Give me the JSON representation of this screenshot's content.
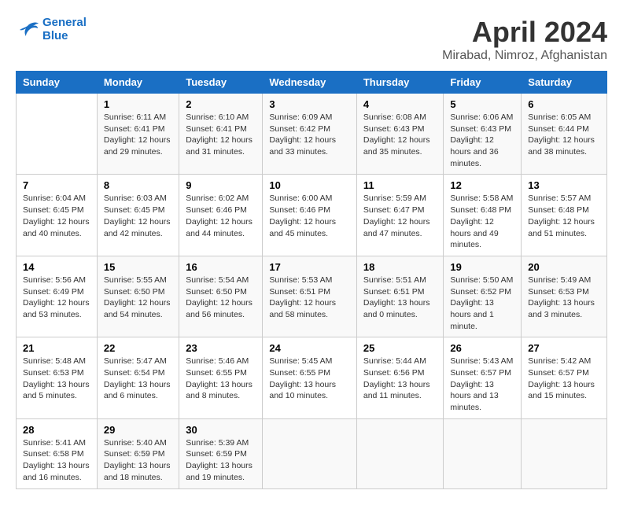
{
  "header": {
    "logo_line1": "General",
    "logo_line2": "Blue",
    "title": "April 2024",
    "subtitle": "Mirabad, Nimroz, Afghanistan"
  },
  "days_of_week": [
    "Sunday",
    "Monday",
    "Tuesday",
    "Wednesday",
    "Thursday",
    "Friday",
    "Saturday"
  ],
  "weeks": [
    [
      {
        "day": "",
        "sunrise": "",
        "sunset": "",
        "daylight": ""
      },
      {
        "day": "1",
        "sunrise": "Sunrise: 6:11 AM",
        "sunset": "Sunset: 6:41 PM",
        "daylight": "Daylight: 12 hours and 29 minutes."
      },
      {
        "day": "2",
        "sunrise": "Sunrise: 6:10 AM",
        "sunset": "Sunset: 6:41 PM",
        "daylight": "Daylight: 12 hours and 31 minutes."
      },
      {
        "day": "3",
        "sunrise": "Sunrise: 6:09 AM",
        "sunset": "Sunset: 6:42 PM",
        "daylight": "Daylight: 12 hours and 33 minutes."
      },
      {
        "day": "4",
        "sunrise": "Sunrise: 6:08 AM",
        "sunset": "Sunset: 6:43 PM",
        "daylight": "Daylight: 12 hours and 35 minutes."
      },
      {
        "day": "5",
        "sunrise": "Sunrise: 6:06 AM",
        "sunset": "Sunset: 6:43 PM",
        "daylight": "Daylight: 12 hours and 36 minutes."
      },
      {
        "day": "6",
        "sunrise": "Sunrise: 6:05 AM",
        "sunset": "Sunset: 6:44 PM",
        "daylight": "Daylight: 12 hours and 38 minutes."
      }
    ],
    [
      {
        "day": "7",
        "sunrise": "Sunrise: 6:04 AM",
        "sunset": "Sunset: 6:45 PM",
        "daylight": "Daylight: 12 hours and 40 minutes."
      },
      {
        "day": "8",
        "sunrise": "Sunrise: 6:03 AM",
        "sunset": "Sunset: 6:45 PM",
        "daylight": "Daylight: 12 hours and 42 minutes."
      },
      {
        "day": "9",
        "sunrise": "Sunrise: 6:02 AM",
        "sunset": "Sunset: 6:46 PM",
        "daylight": "Daylight: 12 hours and 44 minutes."
      },
      {
        "day": "10",
        "sunrise": "Sunrise: 6:00 AM",
        "sunset": "Sunset: 6:46 PM",
        "daylight": "Daylight: 12 hours and 45 minutes."
      },
      {
        "day": "11",
        "sunrise": "Sunrise: 5:59 AM",
        "sunset": "Sunset: 6:47 PM",
        "daylight": "Daylight: 12 hours and 47 minutes."
      },
      {
        "day": "12",
        "sunrise": "Sunrise: 5:58 AM",
        "sunset": "Sunset: 6:48 PM",
        "daylight": "Daylight: 12 hours and 49 minutes."
      },
      {
        "day": "13",
        "sunrise": "Sunrise: 5:57 AM",
        "sunset": "Sunset: 6:48 PM",
        "daylight": "Daylight: 12 hours and 51 minutes."
      }
    ],
    [
      {
        "day": "14",
        "sunrise": "Sunrise: 5:56 AM",
        "sunset": "Sunset: 6:49 PM",
        "daylight": "Daylight: 12 hours and 53 minutes."
      },
      {
        "day": "15",
        "sunrise": "Sunrise: 5:55 AM",
        "sunset": "Sunset: 6:50 PM",
        "daylight": "Daylight: 12 hours and 54 minutes."
      },
      {
        "day": "16",
        "sunrise": "Sunrise: 5:54 AM",
        "sunset": "Sunset: 6:50 PM",
        "daylight": "Daylight: 12 hours and 56 minutes."
      },
      {
        "day": "17",
        "sunrise": "Sunrise: 5:53 AM",
        "sunset": "Sunset: 6:51 PM",
        "daylight": "Daylight: 12 hours and 58 minutes."
      },
      {
        "day": "18",
        "sunrise": "Sunrise: 5:51 AM",
        "sunset": "Sunset: 6:51 PM",
        "daylight": "Daylight: 13 hours and 0 minutes."
      },
      {
        "day": "19",
        "sunrise": "Sunrise: 5:50 AM",
        "sunset": "Sunset: 6:52 PM",
        "daylight": "Daylight: 13 hours and 1 minute."
      },
      {
        "day": "20",
        "sunrise": "Sunrise: 5:49 AM",
        "sunset": "Sunset: 6:53 PM",
        "daylight": "Daylight: 13 hours and 3 minutes."
      }
    ],
    [
      {
        "day": "21",
        "sunrise": "Sunrise: 5:48 AM",
        "sunset": "Sunset: 6:53 PM",
        "daylight": "Daylight: 13 hours and 5 minutes."
      },
      {
        "day": "22",
        "sunrise": "Sunrise: 5:47 AM",
        "sunset": "Sunset: 6:54 PM",
        "daylight": "Daylight: 13 hours and 6 minutes."
      },
      {
        "day": "23",
        "sunrise": "Sunrise: 5:46 AM",
        "sunset": "Sunset: 6:55 PM",
        "daylight": "Daylight: 13 hours and 8 minutes."
      },
      {
        "day": "24",
        "sunrise": "Sunrise: 5:45 AM",
        "sunset": "Sunset: 6:55 PM",
        "daylight": "Daylight: 13 hours and 10 minutes."
      },
      {
        "day": "25",
        "sunrise": "Sunrise: 5:44 AM",
        "sunset": "Sunset: 6:56 PM",
        "daylight": "Daylight: 13 hours and 11 minutes."
      },
      {
        "day": "26",
        "sunrise": "Sunrise: 5:43 AM",
        "sunset": "Sunset: 6:57 PM",
        "daylight": "Daylight: 13 hours and 13 minutes."
      },
      {
        "day": "27",
        "sunrise": "Sunrise: 5:42 AM",
        "sunset": "Sunset: 6:57 PM",
        "daylight": "Daylight: 13 hours and 15 minutes."
      }
    ],
    [
      {
        "day": "28",
        "sunrise": "Sunrise: 5:41 AM",
        "sunset": "Sunset: 6:58 PM",
        "daylight": "Daylight: 13 hours and 16 minutes."
      },
      {
        "day": "29",
        "sunrise": "Sunrise: 5:40 AM",
        "sunset": "Sunset: 6:59 PM",
        "daylight": "Daylight: 13 hours and 18 minutes."
      },
      {
        "day": "30",
        "sunrise": "Sunrise: 5:39 AM",
        "sunset": "Sunset: 6:59 PM",
        "daylight": "Daylight: 13 hours and 19 minutes."
      },
      {
        "day": "",
        "sunrise": "",
        "sunset": "",
        "daylight": ""
      },
      {
        "day": "",
        "sunrise": "",
        "sunset": "",
        "daylight": ""
      },
      {
        "day": "",
        "sunrise": "",
        "sunset": "",
        "daylight": ""
      },
      {
        "day": "",
        "sunrise": "",
        "sunset": "",
        "daylight": ""
      }
    ]
  ]
}
